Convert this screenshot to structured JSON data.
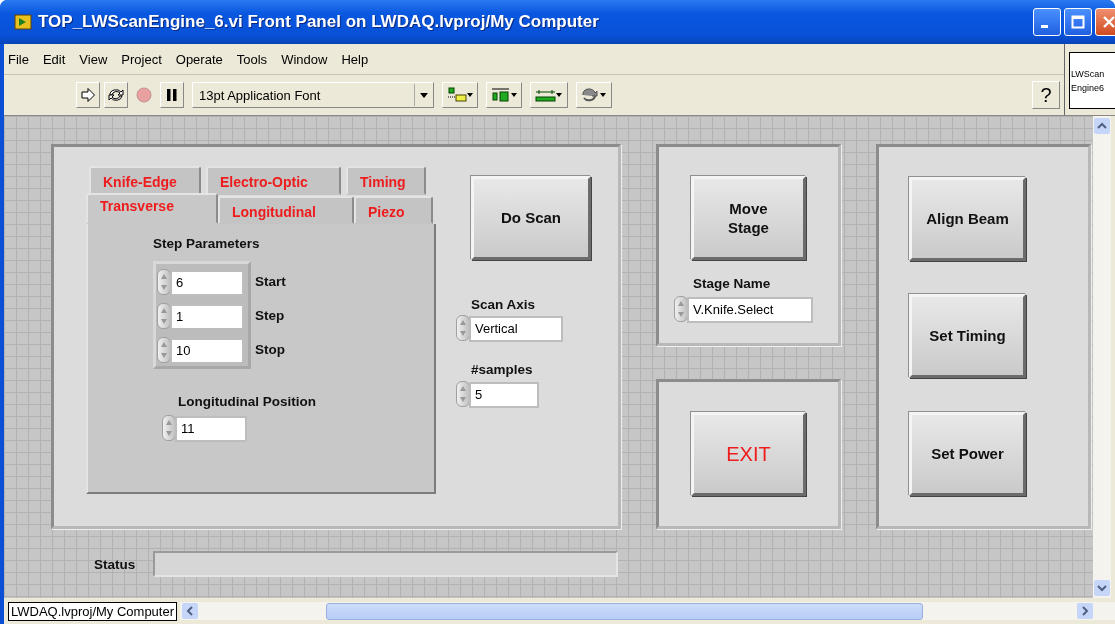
{
  "window": {
    "title": "TOP_LWScanEngine_6.vi Front Panel on LWDAQ.lvproj/My Computer"
  },
  "menu": [
    "File",
    "Edit",
    "View",
    "Project",
    "Operate",
    "Tools",
    "Window",
    "Help"
  ],
  "toolbar": {
    "run_buttons": [
      {
        "kind": "run",
        "disabled": false
      },
      {
        "kind": "run-continuous",
        "disabled": false
      },
      {
        "kind": "abort",
        "disabled": true
      },
      {
        "kind": "pause",
        "disabled": false
      }
    ],
    "font_selector": "13pt Application Font",
    "edit_buttons": [
      {
        "kind": "align"
      },
      {
        "kind": "distribute"
      },
      {
        "kind": "resize"
      },
      {
        "kind": "reorder"
      }
    ],
    "help": "?"
  },
  "vi_icon": [
    "LWScan",
    "Engine6"
  ],
  "scan_panel": {
    "tabs_back": [
      {
        "label": "Knife-Edge",
        "selected": false
      },
      {
        "label": "Electro-Optic",
        "selected": false
      },
      {
        "label": "Timing",
        "selected": false
      }
    ],
    "tabs_front": [
      {
        "label": "Transverse",
        "selected": true
      },
      {
        "label": "Longitudinal",
        "selected": false
      },
      {
        "label": "Piezo",
        "selected": false
      }
    ],
    "step_parameters": {
      "label": "Step Parameters",
      "rows": [
        {
          "value": "6",
          "label": "Start"
        },
        {
          "value": "1",
          "label": "Step"
        },
        {
          "value": "10",
          "label": "Stop"
        }
      ]
    },
    "longitudinal_position": {
      "label": "Longitudinal Position",
      "value": "11"
    },
    "do_scan": "Do Scan",
    "scan_axis": {
      "label": "Scan Axis",
      "value": "Vertical"
    },
    "samples": {
      "label": "#samples",
      "value": "5"
    }
  },
  "stage_panel": {
    "button": "Move Stage",
    "stage_name": {
      "label": "Stage Name",
      "value": "V.Knife.Select"
    }
  },
  "exit_panel": {
    "button": "EXIT"
  },
  "action_panel": {
    "buttons": [
      "Align Beam",
      "Set Timing",
      "Set Power"
    ]
  },
  "status": {
    "label": "Status"
  },
  "project_path": "LWDAQ.lvproj/My Computer"
}
